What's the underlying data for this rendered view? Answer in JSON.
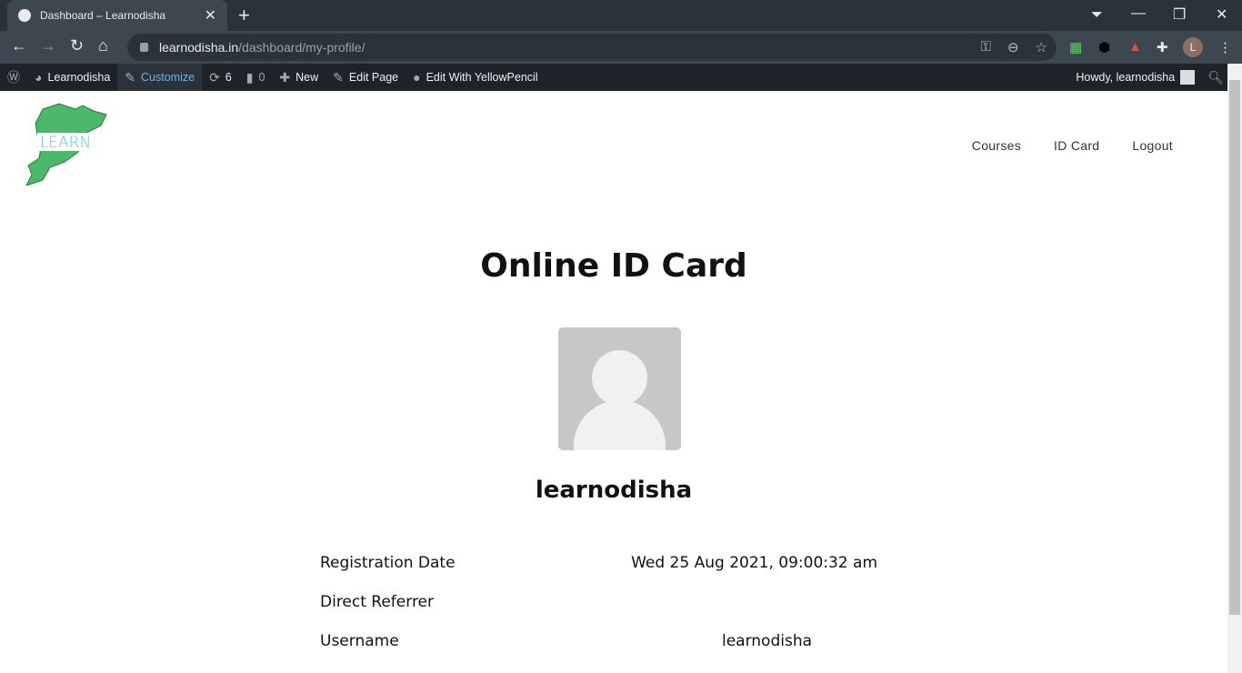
{
  "browser": {
    "tab_title": "Dashboard – Learnodisha",
    "url_host": "learnodisha.in",
    "url_path": "/dashboard/my-profile/",
    "profile_initial": "L"
  },
  "adminbar": {
    "site": "Learnodisha",
    "customize": "Customize",
    "updates": "6",
    "comments": "0",
    "new": "New",
    "edit_page": "Edit Page",
    "yellowpencil": "Edit With YellowPencil",
    "howdy": "Howdy, learnodisha"
  },
  "logo": {
    "text": "LEARN"
  },
  "menu": [
    {
      "label": "Courses"
    },
    {
      "label": "ID Card"
    },
    {
      "label": "Logout"
    }
  ],
  "page": {
    "title": "Online ID Card",
    "username_heading": "learnodisha",
    "fields": [
      {
        "label": "Registration Date",
        "value": "Wed 25 Aug 2021, 09:00:32 am"
      },
      {
        "label": "Direct Referrer",
        "value": ""
      },
      {
        "label": "Username",
        "value": "learnodisha"
      }
    ]
  },
  "colors": {
    "admin_bar": "#1d2327",
    "accent": "#72aee6",
    "logo_green": "#4cb86a"
  }
}
